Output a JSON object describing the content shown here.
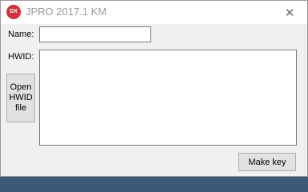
{
  "window": {
    "title": "JPRO 2017.1 KM",
    "icon": "DX",
    "close_glyph": "✕"
  },
  "form": {
    "name_label": "Name:",
    "name_value": "",
    "hwid_label": "HWID:",
    "hwid_value": "",
    "open_button_label": "Open\nHWID\nfile",
    "make_key_label": "Make key"
  },
  "colors": {
    "app_icon": "#d6303a",
    "title_text": "#9a9a9a",
    "window_bg": "#f0f0f0",
    "button_bg": "#e1e1e1"
  }
}
